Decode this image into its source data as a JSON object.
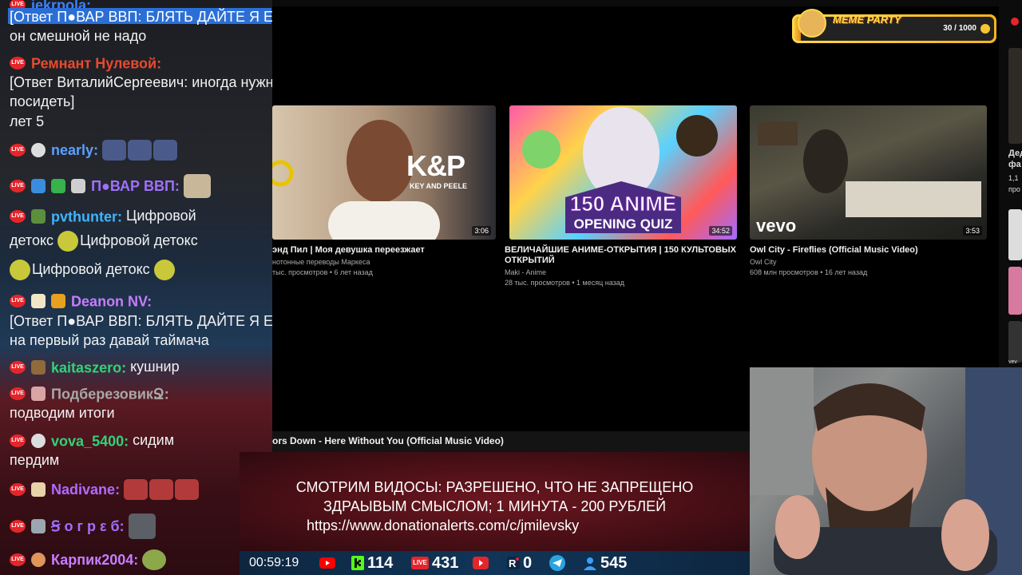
{
  "chat": {
    "messages": [
      {
        "type": "nick_only",
        "nick": "jekrpola:",
        "nick_color": "#3c82ff"
      },
      {
        "type": "reply",
        "text": "[Ответ П●ВАР ВВП: БЛЯТЬ ДАЙТЕ Я ЕМУ БАН ДАМ]"
      },
      {
        "type": "text",
        "text": "он смешной не надо"
      },
      {
        "type": "message",
        "nick": "Ремнант Нулевой:",
        "nick_color": "#e84a2e",
        "text": ""
      },
      {
        "type": "reply",
        "text": "[Ответ ВиталийСергеевич: иногда нужно просто"
      },
      {
        "type": "reply",
        "text": "посидеть]"
      },
      {
        "type": "text",
        "text": "лет 5"
      },
      {
        "type": "message",
        "nick": "nearly:",
        "nick_color": "#5aa0ff",
        "text": ""
      },
      {
        "type": "message",
        "nick": "П●ВАР ВВП:",
        "nick_color": "#a070ff",
        "text": ""
      },
      {
        "type": "message",
        "nick": "pvthunter:",
        "nick_color": "#3fb5ff",
        "text": "Цифровой"
      },
      {
        "type": "text",
        "text": "детокс"
      },
      {
        "type": "text",
        "text": "Цифровой детокс"
      },
      {
        "type": "text",
        "text": "Цифровой детокс"
      },
      {
        "type": "message",
        "nick": "Deanon NV:",
        "nick_color": "#c77dff",
        "text": ""
      },
      {
        "type": "reply",
        "text": "[Ответ П●ВАР ВВП: БЛЯТЬ ДАЙТЕ Я ЕМУ БАН ДАМ]"
      },
      {
        "type": "text",
        "text": "на первый раз давай таймача"
      },
      {
        "type": "message",
        "nick": "kaitaszero:",
        "nick_color": "#33d17a",
        "text": "кушнир"
      },
      {
        "type": "message",
        "nick": "ПодберезовикՋ:",
        "nick_color": "#a8a8a8",
        "text": ""
      },
      {
        "type": "text",
        "text": "подводим итоги"
      },
      {
        "type": "message",
        "nick": "vova_5400:",
        "nick_color": "#33d17a",
        "text": "сидим"
      },
      {
        "type": "text",
        "text": "пердим"
      },
      {
        "type": "message",
        "nick": "Nadivane:",
        "nick_color": "#b06bff",
        "text": ""
      },
      {
        "type": "message",
        "nick": "Ꞩ ο г р ε б:",
        "nick_color": "#a070ff",
        "text": ""
      },
      {
        "type": "message",
        "nick": "Карпик2004:",
        "nick_color": "#c77dff",
        "text": ""
      }
    ],
    "live_badge": "LIVE"
  },
  "videos": [
    {
      "title": "энд Пил | Моя девушка переезжает",
      "channel": "нотонные переводы Маркеса",
      "stats": "тыс. просмотров • 6 лет назад",
      "duration": "3:06",
      "thumb_text": "K&P",
      "thumb_sub": "KEY AND PEELE"
    },
    {
      "title": "ВЕЛИЧАЙШИЕ АНИМЕ-ОТКРЫТИЯ | 150 КУЛЬТОВЫХ ОТКРЫТИЙ",
      "channel": "Maki - Anime",
      "stats": "28 тыс. просмотров • 1 месяц назад",
      "duration": "34:52",
      "thumb_text": "150 ANIME",
      "thumb_sub": "OPENING QUIZ"
    },
    {
      "title": "Owl City - Fireflies (Official Music Video)",
      "channel": "Owl City",
      "stats": "608 млн просмотров • 16 лет назад",
      "duration": "3:53",
      "thumb_text": "vevo"
    }
  ],
  "right_strip": {
    "title1": "Дед",
    "title2": "фа",
    "meta1": "1,1",
    "meta2": "про",
    "logo": "vev"
  },
  "meme_party": {
    "title": "MEME PARTY",
    "progress_text": "30 / 1000",
    "progress": 0.03
  },
  "now_playing": {
    "title": "ors Down - Here Without You (Official Music Video)"
  },
  "rules": {
    "line1": "СМОТРИМ ВИДОСЫ: РАЗРЕШЕНО, ЧТО НЕ ЗАПРЕЩЕНО",
    "line2": "ЗДРАЫВЫМ СМЫСЛОМ; 1 МИНУТА - 200 РУБЛЕЙ",
    "line3": "https://www.donationalerts.com/c/jmilevsky"
  },
  "stats": {
    "uptime": "00:59:19",
    "kick_viewers": "114",
    "vk_viewers": "431",
    "rutube_viewers": "0",
    "total_viewers": "545"
  },
  "colors": {
    "youtube_red": "#ff0000",
    "kick_green": "#53fc18",
    "telegram_blue": "#2aa3df",
    "meme_gold": "#f6b51a"
  }
}
